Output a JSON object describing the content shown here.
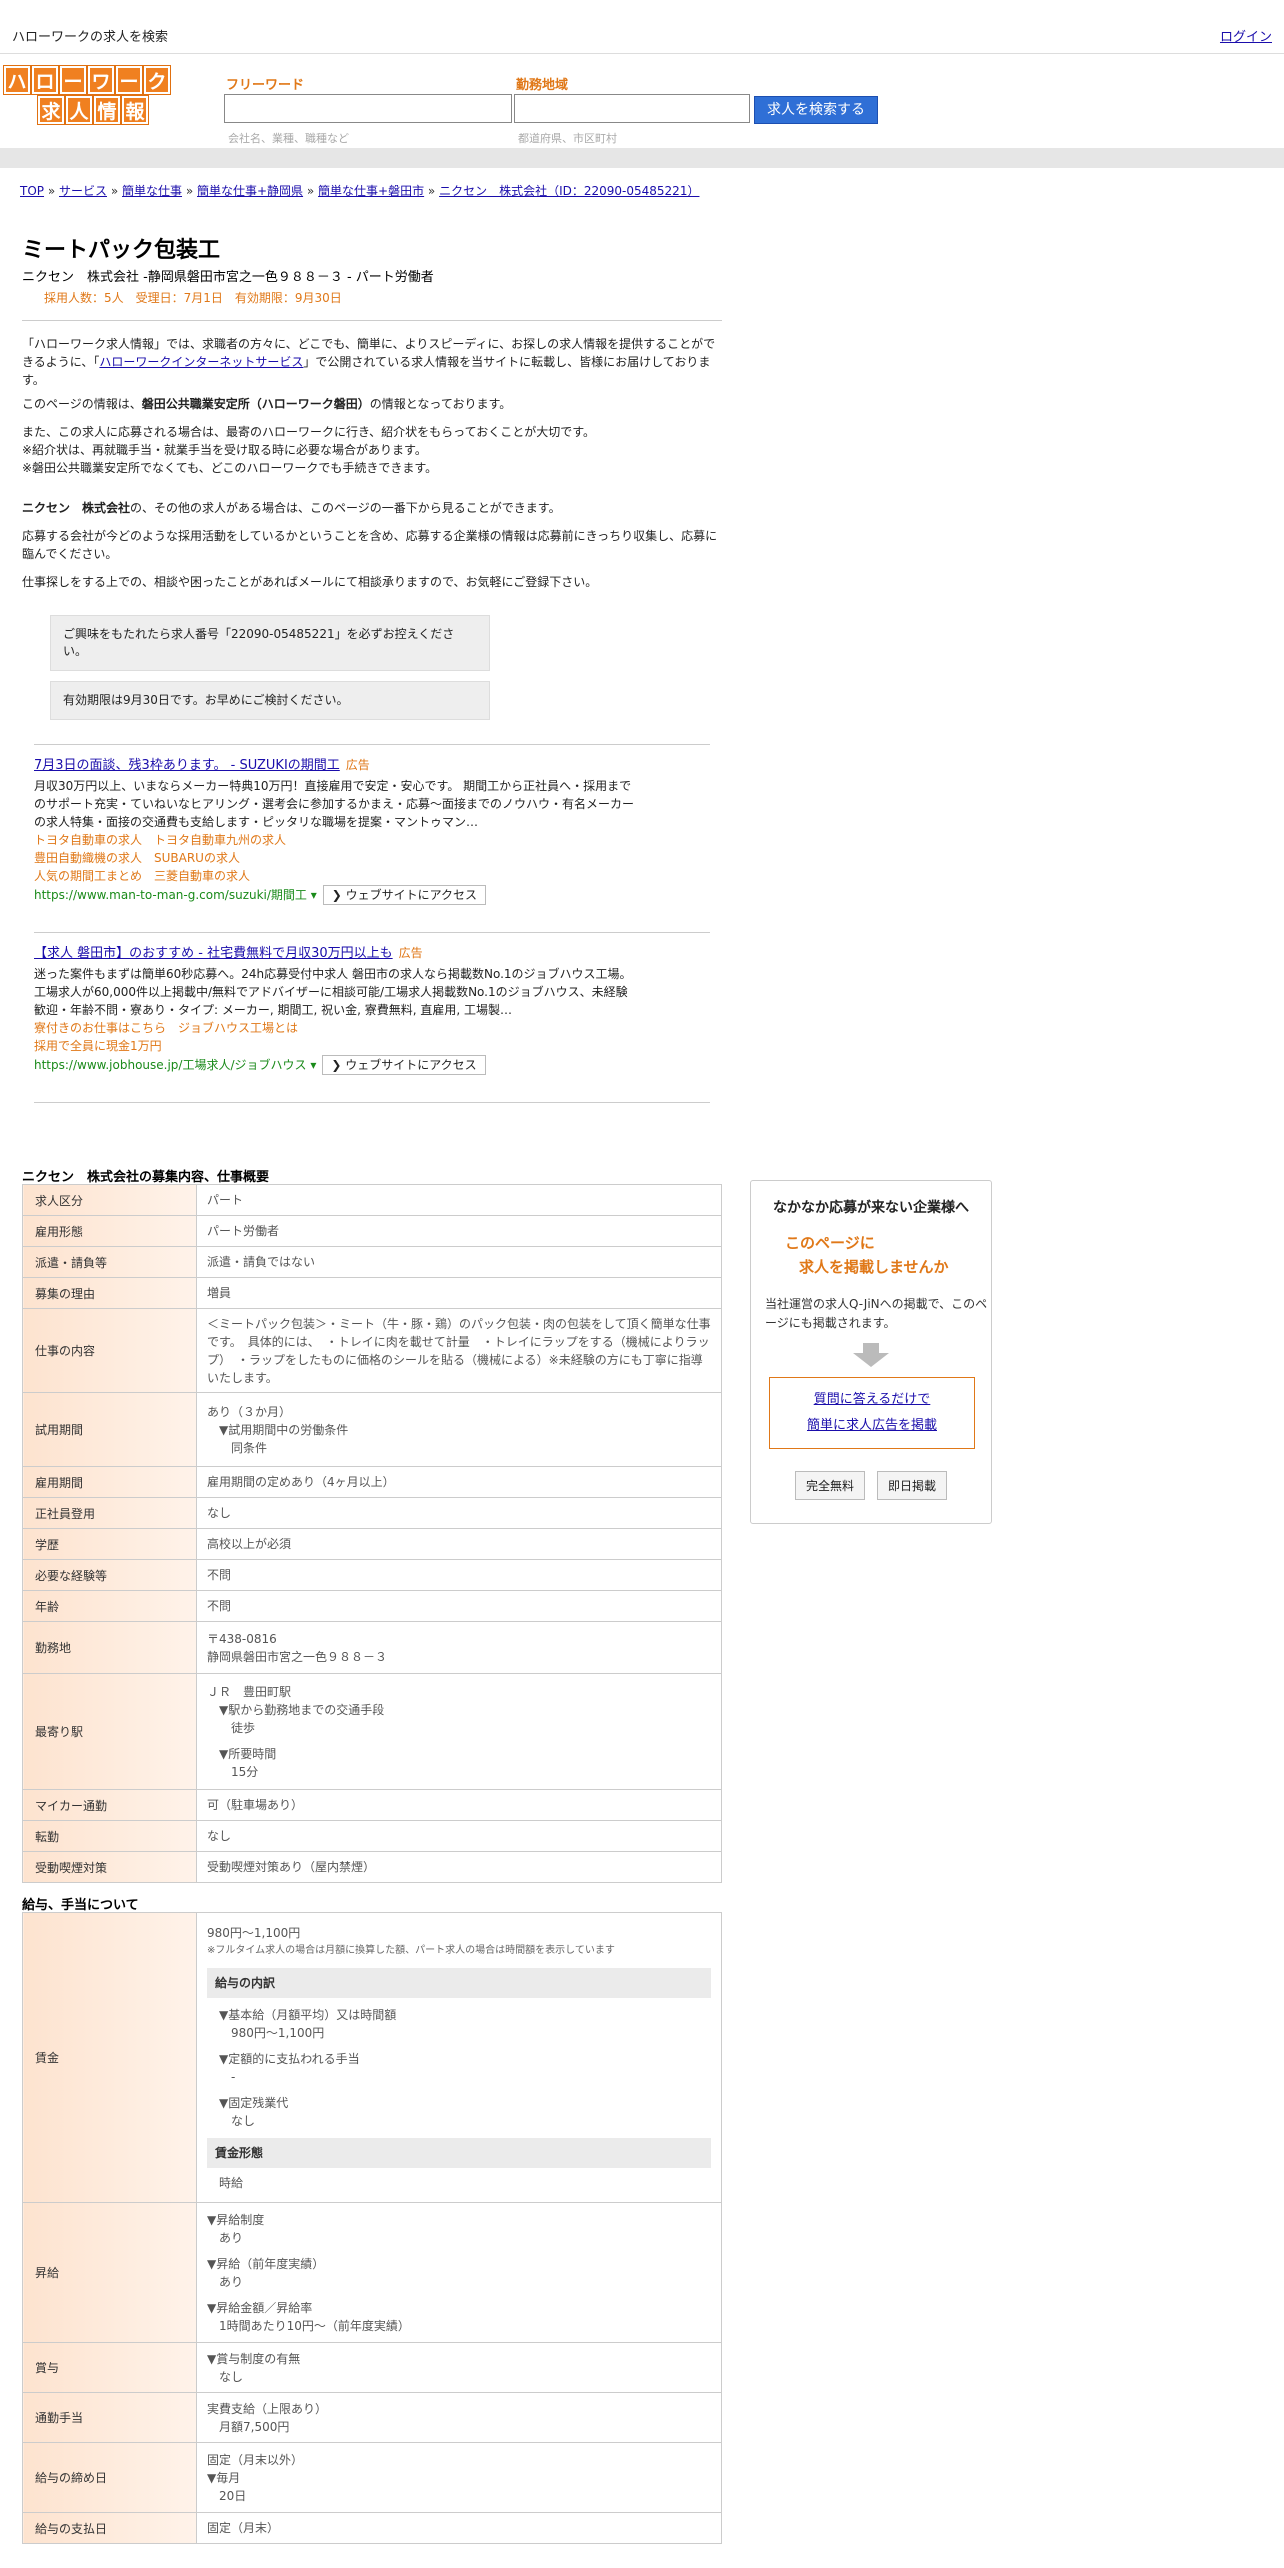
{
  "topbar": {
    "title": "ハローワークの求人を検索",
    "login": "ログイン"
  },
  "logo": {
    "row1": [
      "ハ",
      "ロ",
      "ー",
      "ワ",
      "ー",
      "ク"
    ],
    "row2": [
      "求",
      "人",
      "情",
      "報"
    ]
  },
  "search": {
    "freeword_label": "フリーワード",
    "freeword_placeholder": "会社名、業種、職種など",
    "area_label": "勤務地域",
    "area_placeholder": "都道府県、市区町村",
    "button": "求人を検索する"
  },
  "breadcrumb": {
    "items": [
      "TOP",
      "サービス",
      "簡単な仕事",
      "簡単な仕事+静岡県",
      "簡単な仕事+磐田市",
      "ニクセン　株式会社（ID：22090-05485221）"
    ],
    "sep": " » "
  },
  "job": {
    "title": "ミートパック包装工",
    "company_line": "ニクセン　株式会社 -静岡県磐田市宮之一色９８８－３ - パート労働者",
    "meta": "採用人数：5人　受理日：7月1日　有効期限：9月30日"
  },
  "intro": {
    "p1a": "「ハローワーク求人情報」では、求職者の方々に、どこでも、簡単に、よりスピーディに、お探しの求人情報を提供することができるように、「",
    "p1link": "ハローワークインターネットサービス",
    "p1b": "」で公開されている求人情報を当サイトに転載し、皆様にお届けしております。",
    "p2a": "このページの情報は、",
    "p2b": "磐田公共職業安定所（ハローワーク磐田）",
    "p2c": "の情報となっております。",
    "p3": [
      "また、この求人に応募される場合は、最寄のハローワークに行き、紹介状をもらっておくことが大切です。",
      "※紹介状は、再就職手当・就業手当を受け取る時に必要な場合があります。",
      "※磐田公共職業安定所でなくても、どこのハローワークでも手続きできます。"
    ],
    "p4a": "ニクセン　株式会社",
    "p4b": "の、その他の求人がある場合は、このページの一番下から見ることができます。",
    "p5": "応募する会社が今どのような採用活動をしているかということを含め、応募する企業様の情報は応募前にきっちり収集し、応募に臨んでください。",
    "p6": "仕事探しをする上での、相談や困ったことがあればメールにて相談承りますので、お気軽にご登録下さい。",
    "note1": "ご興味をもたれたら求人番号「22090-05485221」を必ずお控えください。",
    "note2": "有効期限は9月30日です。お早めにご検討ください。"
  },
  "ads": [
    {
      "headline": "7月3日の面談、残3枠あります。 - SUZUKIの期間工",
      "tag": "広告",
      "desc": "月収30万円以上、いまならメーカー特典10万円！直接雇用で安定・安心です。 期間工から正社員へ・採用までのサポート充実・ていねいなヒアリング・選考会に参加するかまえ・応募～面接までのノウハウ・有名メーカーの求人特集・面接の交通費も支給します・ピッタリな職場を提案・マントゥマン…",
      "links": [
        "トヨタ自動車の求人　トヨタ自動車九州の求人",
        "豊田自動織機の求人　SUBARUの求人",
        "人気の期間工まとめ　三菱自動車の求人"
      ],
      "url": "https://www.man-to-man-g.com/suzuki/期間工 ▾",
      "visit": "ウェブサイトにアクセス"
    },
    {
      "headline": "【求人 磐田市】のおすすめ - 社宅費無料で月収30万円以上も",
      "tag": "広告",
      "desc": "迷った案件もまずは簡単60秒応募へ。24h応募受付中求人 磐田市の求人なら掲載数No.1のジョブハウス工場。工場求人が60,000件以上掲載中/無料でアドバイザーに相談可能/工場求人掲載数No.1のジョブハウス、未経験歓迎・年齢不問・寮あり・タイプ: メーカー, 期間工, 祝い金, 寮費無料, 直雇用, 工場製…",
      "links": [
        "寮付きのお仕事はこちら　ジョブハウス工場とは",
        "採用で全員に現金1万円"
      ],
      "url": "https://www.jobhouse.jp/工場求人/ジョブハウス ▾",
      "visit": "ウェブサイトにアクセス"
    }
  ],
  "section1": {
    "title": "ニクセン　株式会社の募集内容、仕事概要",
    "rows": [
      {
        "k": "求人区分",
        "v": "パート"
      },
      {
        "k": "雇用形態",
        "v": "パート労働者"
      },
      {
        "k": "派遣・請負等",
        "v": "派遣・請負ではない"
      },
      {
        "k": "募集の理由",
        "v": "増員"
      },
      {
        "k": "仕事の内容",
        "v": "＜ミートパック包装＞・ミート（牛・豚・鶏）のパック包装・肉の包装をして頂く簡単な仕事です。　具体的には、　・トレイに肉を載せて計量　・トレイにラップをする（機械によりラップ）　・ラップをしたものに価格のシールを貼る（機械による）※未経験の方にも丁寧に指導いたします。"
      },
      {
        "k": "試用期間",
        "v": "あり（３か月）",
        "sub": [
          "▼試用期間中の労働条件",
          "同条件"
        ]
      },
      {
        "k": "雇用期間",
        "v": "雇用期間の定めあり（4ヶ月以上）"
      },
      {
        "k": "正社員登用",
        "v": "なし"
      },
      {
        "k": "学歴",
        "v": "高校以上が必須"
      },
      {
        "k": "必要な経験等",
        "v": "不問"
      },
      {
        "k": "年齢",
        "v": "不問"
      },
      {
        "k": "勤務地",
        "v": "〒438-0816",
        "v2": "静岡県磐田市宮之一色９８８－３"
      },
      {
        "k": "最寄り駅",
        "v": "ＪＲ　豊田町駅",
        "sub": [
          "▼駅から勤務地までの交通手段",
          "徒歩",
          "▼所要時間",
          "15分"
        ]
      },
      {
        "k": "マイカー通勤",
        "v": "可（駐車場あり）"
      },
      {
        "k": "転勤",
        "v": "なし"
      },
      {
        "k": "受動喫煙対策",
        "v": "受動喫煙対策あり（屋内禁煙）"
      }
    ]
  },
  "section2": {
    "title": "給与、手当について",
    "wage": {
      "k": "賃金",
      "v": "980円〜1,100円",
      "note": "※フルタイム求人の場合は月額に換算した額、パート求人の場合は時間額を表示しています",
      "breakdown_label": "給与の内訳",
      "b1": "▼基本給（月額平均）又は時間額",
      "b1v": "980円〜1,100円",
      "b2": "▼定額的に支払われる手当",
      "b2v": "-",
      "b3": "▼固定残業代",
      "b3v": "なし",
      "form_label": "賃金形態",
      "form": "時給"
    },
    "raise": {
      "k": "昇給",
      "a1": "▼昇給制度",
      "a1v": "あり",
      "a2": "▼昇給（前年度実績）",
      "a2v": "あり",
      "a3": "▼昇給金額／昇給率",
      "a3v": "1時間あたり10円〜（前年度実績）"
    },
    "bonus": {
      "k": "賞与",
      "a1": "▼賞与制度の有無",
      "a1v": "なし"
    },
    "commute": {
      "k": "通勤手当",
      "v": "実費支給（上限あり）",
      "v2": "月額7,500円"
    },
    "cutoff": {
      "k": "給与の締め日",
      "v": "固定（月末以外）",
      "a": "▼毎月",
      "av": "20日"
    },
    "payday": {
      "k": "給与の支払日",
      "v": "固定（月末）"
    }
  },
  "sidebar": {
    "title": "なかなか応募が来ない企業様へ",
    "catch1": "このページに",
    "catch2": "求人を掲載しませんか",
    "desc": "当社運営の求人Q-JiNへの掲載で、このページにも掲載されます。",
    "link1": "質問に答えるだけで",
    "link2": "簡単に求人広告を掲載",
    "btn1": "完全無料",
    "btn2": "即日掲載"
  }
}
